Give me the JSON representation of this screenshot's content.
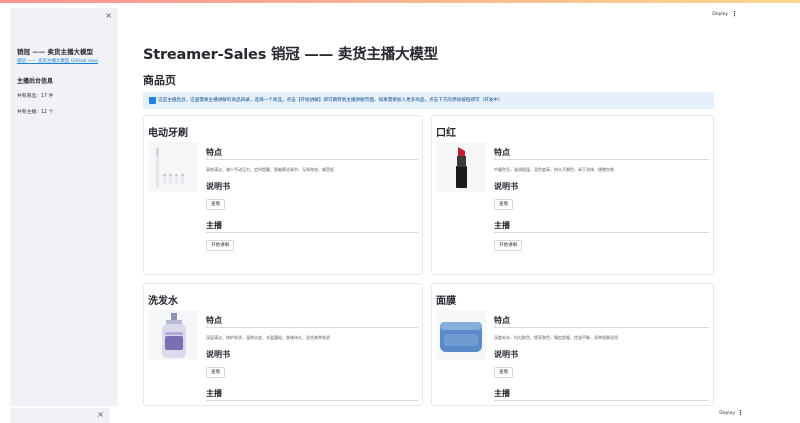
{
  "sidebar": {
    "close_icon": "×",
    "title": "销冠 —— 卖货主播大模型",
    "link": "销冠 —— 卖货主播大模型 GitHub repo",
    "info_title": "主播后台信息",
    "products_count": "共有商品：17 件",
    "streamers_count": "共有主播：12 个"
  },
  "header": {
    "deploy": "Deploy",
    "menu_icon": "⋮"
  },
  "main": {
    "title": "Streamer-Sales 销冠 —— 卖货主播大模型",
    "subtitle": "商品页",
    "info": "这是主播后台，这里需要主播讲解的商品目录，选择一个商品，点击【开始讲解】即可跳转到主播讲解页面。如果需要加入更多商品，点击下方的添加按钮即可（开发中）"
  },
  "labels": {
    "features": "特点",
    "manual": "说明书",
    "host": "主播",
    "view": "查看",
    "start": "开始讲解"
  },
  "products": [
    {
      "name": "电动牙刷",
      "features": "高效清洁、减少手动压力、定时提醒、智能模式调节、无线充电、噪音低"
    },
    {
      "name": "口红",
      "features": "中量色号、滋润保湿、显色度高、持久不脱色、易于涂抹、便携包装"
    },
    {
      "name": "洗发水",
      "features": "深层清洁、修护发质、温和头皮、丰盈蓬松、香味持久、适合各种发质"
    },
    {
      "name": "面膜",
      "features": "深度补水、均匀肤色、提亮肤色、镇定舒缓、控油平衡、多种肌肤适用"
    }
  ],
  "bottom": {
    "close_icon": "×",
    "deploy": "Deploy",
    "menu_icon": "⋮"
  }
}
